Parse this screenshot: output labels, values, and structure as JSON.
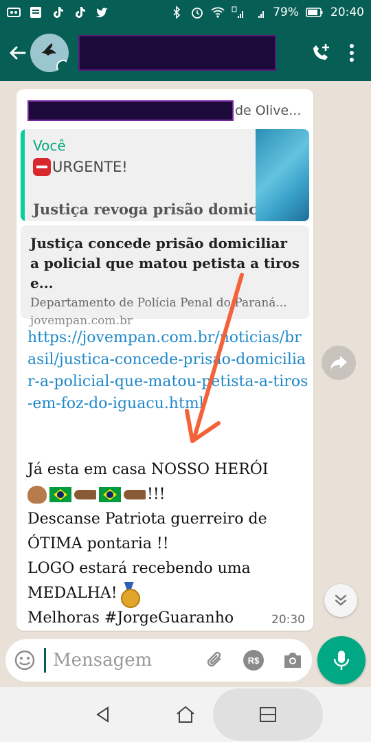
{
  "status_bar": {
    "battery": "79%",
    "time": "20:40"
  },
  "header": {
    "contact_name_redacted": true
  },
  "message": {
    "sender_suffix": "de Olive...",
    "quote": {
      "author": "Você",
      "urgent_text": "URGENTE!",
      "title": "Justiça revoga prisão domic..."
    },
    "preview": {
      "title": "Justiça concede prisão domiciliar a policial que matou petista a tiros e...",
      "description": "Departamento de Polícia Penal do Paraná...",
      "domain": "jovempan.com.br"
    },
    "link": "https://jovempan.com.br/noticias/brasil/justica-concede-prisao-domiciliar-a-policial-que-matou-petista-a-tiros-em-foz-do-iguacu.html",
    "text_lines": {
      "l1": "Já esta em casa NOSSO HERÓI",
      "l2_tail": "!!!",
      "l3": "Descanse Patriota guerreiro de",
      "l4": "ÓTIMA pontaria !!",
      "l5": "LOGO estará recebendo uma",
      "l6": "MEDALHA!",
      "l7": " Melhoras #JorgeGuaranho"
    },
    "time": "20:30"
  },
  "input": {
    "placeholder": "Mensagem"
  },
  "colors": {
    "header": "#075e54",
    "accent": "#00a884",
    "link": "#1e88c9",
    "arrow": "#f4623a"
  }
}
